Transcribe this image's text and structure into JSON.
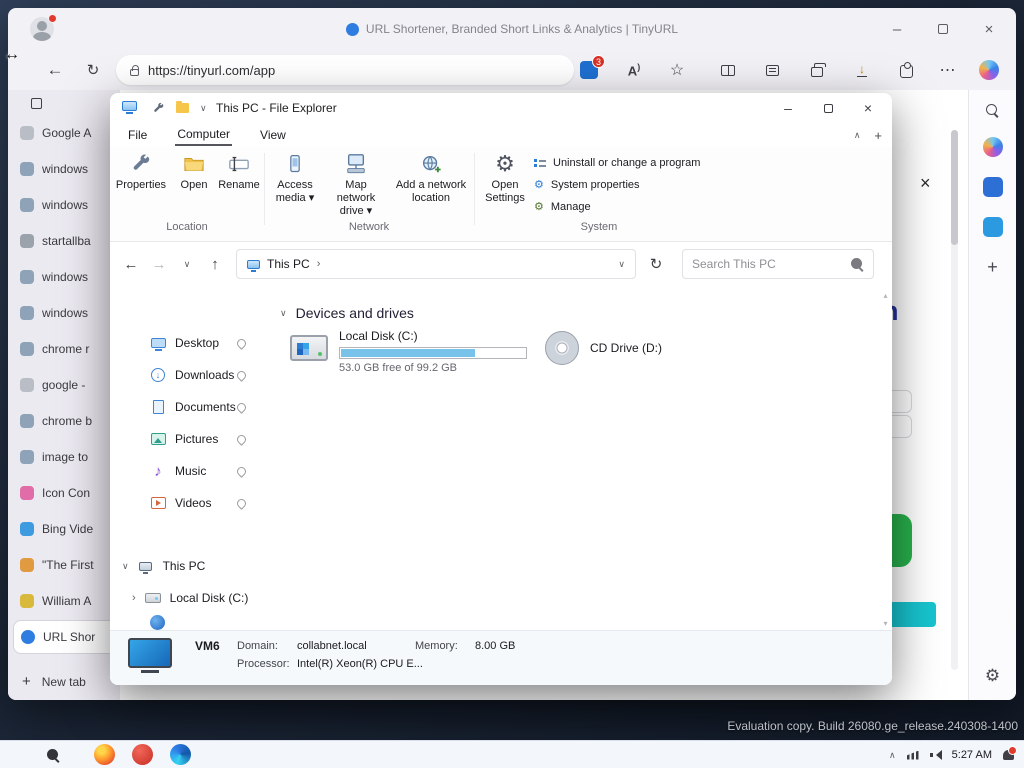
{
  "desktop": {
    "watermark": "Evaluation copy. Build 26080.ge_release.240308-1400"
  },
  "taskbar": {
    "time": "5:27 AM"
  },
  "browser": {
    "title": "URL Shortener, Branded Short Links & Analytics | TinyURL",
    "url": "https://tinyurl.com/app",
    "extension_badge": "3",
    "new_tab": "New tab",
    "page": {
      "partial_heading": "h"
    },
    "tabs": [
      {
        "label": "Google A",
        "icon_style": "background:#b9bec6"
      },
      {
        "label": "windows",
        "icon_style": "background:#8ea2b8"
      },
      {
        "label": "windows",
        "icon_style": "background:#8ea2b8"
      },
      {
        "label": "startallba",
        "icon_style": "background:#9aa2ac"
      },
      {
        "label": "windows",
        "icon_style": "background:#8ea2b8"
      },
      {
        "label": "windows",
        "icon_style": "background:#8ea2b8"
      },
      {
        "label": "chrome r",
        "icon_style": "background:#8ea2b8"
      },
      {
        "label": "google -",
        "icon_style": "background:#b9bec6"
      },
      {
        "label": "chrome b",
        "icon_style": "background:#8ea2b8"
      },
      {
        "label": "image to",
        "icon_style": "background:#8ea2b8"
      },
      {
        "label": "Icon Con",
        "icon_style": "background:#e06ca8"
      },
      {
        "label": "Bing Vide",
        "icon_style": "background:#3f9be0"
      },
      {
        "label": "\"The First",
        "icon_style": "background:#e09a3f"
      },
      {
        "label": "William A",
        "icon_style": "background:#d8b93c"
      },
      {
        "label": "URL Shor",
        "icon_style": "background:#2f7de1;border-radius:50%"
      }
    ]
  },
  "explorer": {
    "title": "This PC - File Explorer",
    "menu": {
      "file": "File",
      "computer": "Computer",
      "view": "View"
    },
    "ribbon": {
      "properties": "Properties",
      "open": "Open",
      "rename": "Rename",
      "access_media": "Access media ▾",
      "map_drive": "Map network drive ▾",
      "add_location": "Add a network location",
      "open_settings": "Open Settings",
      "uninstall": "Uninstall or change a program",
      "system_properties": "System properties",
      "manage": "Manage",
      "groups": {
        "location": "Location",
        "network": "Network",
        "system": "System"
      }
    },
    "address": {
      "breadcrumb": "This PC"
    },
    "search_placeholder": "Search This PC",
    "nav": [
      {
        "label": "Desktop"
      },
      {
        "label": "Downloads"
      },
      {
        "label": "Documents"
      },
      {
        "label": "Pictures"
      },
      {
        "label": "Music"
      },
      {
        "label": "Videos"
      }
    ],
    "tree": [
      {
        "label": "This PC"
      },
      {
        "label": "Local Disk (C:)"
      }
    ],
    "section": "Devices and drives",
    "drives": [
      {
        "name": "Local Disk (C:)",
        "free_text": "53.0 GB free of 99.2 GB",
        "fill_style": "width:72%"
      },
      {
        "name": "CD Drive (D:)"
      }
    ],
    "status": {
      "machine": "VM6",
      "domain_label": "Domain:",
      "domain_value": "collabnet.local",
      "processor_label": "Processor:",
      "processor_value": "Intel(R) Xeon(R) CPU E...",
      "memory_label": "Memory:",
      "memory_value": "8.00 GB"
    }
  }
}
